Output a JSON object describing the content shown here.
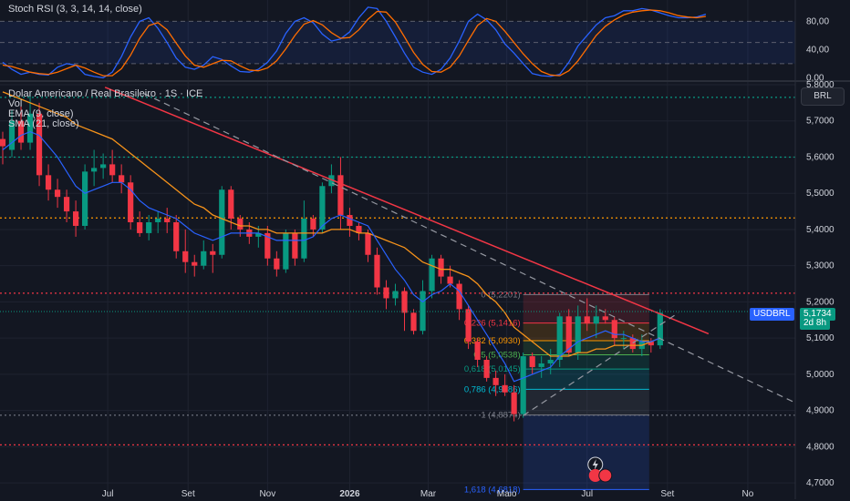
{
  "chart_data": [
    {
      "type": "line",
      "title": "Stoch RSI (3, 3, 14, 14, close)",
      "y_ticks": [
        "80,00",
        "40,00",
        "0,00"
      ],
      "y_tick_values": [
        80,
        40,
        0
      ],
      "ylim": [
        -2,
        105
      ],
      "series": [
        {
          "name": "K",
          "color": "#2962ff",
          "values": [
            22,
            12,
            5,
            8,
            5,
            4,
            15,
            20,
            18,
            5,
            2,
            0,
            8,
            30,
            58,
            80,
            85,
            70,
            50,
            28,
            15,
            12,
            18,
            30,
            26,
            17,
            9,
            8,
            12,
            22,
            38,
            63,
            80,
            85,
            78,
            62,
            52,
            55,
            65,
            85,
            100,
            98,
            80,
            58,
            35,
            15,
            8,
            5,
            12,
            28,
            52,
            80,
            90,
            82,
            68,
            48,
            35,
            20,
            6,
            3,
            2,
            5,
            22,
            45,
            60,
            75,
            85,
            88,
            95,
            95,
            98,
            96,
            92,
            88,
            85,
            85,
            86,
            90
          ]
        },
        {
          "name": "D",
          "color": "#ff6d00",
          "values": [
            18,
            16,
            12,
            8,
            6,
            5,
            8,
            13,
            18,
            14,
            8,
            3,
            3,
            13,
            32,
            56,
            74,
            78,
            68,
            49,
            31,
            18,
            15,
            20,
            25,
            24,
            17,
            11,
            10,
            14,
            24,
            41,
            60,
            76,
            81,
            75,
            64,
            56,
            57,
            68,
            83,
            94,
            93,
            79,
            58,
            36,
            19,
            9,
            8,
            15,
            31,
            53,
            74,
            84,
            80,
            66,
            50,
            34,
            20,
            9,
            4,
            3,
            10,
            24,
            42,
            60,
            73,
            82,
            89,
            93,
            95,
            96,
            95,
            92,
            88,
            86,
            85,
            87
          ]
        }
      ]
    },
    {
      "type": "candlestick",
      "title": "Dolar Americano / Real Brasileiro · 1S · ICE",
      "indicators": [
        "Vol",
        "EMA (9, close)",
        "SMA (21, close)"
      ],
      "currency_button": "BRL",
      "ylim": [
        4.655,
        5.805
      ],
      "y_ticks": [
        "5,8000",
        "5,7000",
        "5,6000",
        "5,5000",
        "5,4000",
        "5,3000",
        "5,2000",
        "5,1000",
        "5,0000",
        "4,9000",
        "4,8000",
        "4,7000"
      ],
      "y_tick_values": [
        5.8,
        5.7,
        5.6,
        5.5,
        5.4,
        5.3,
        5.2,
        5.1,
        5.0,
        4.9,
        4.8,
        4.7
      ],
      "x_ticks": [
        {
          "label": "Jul",
          "index": 11.5
        },
        {
          "label": "Set",
          "index": 20.3
        },
        {
          "label": "Nov",
          "index": 29.0
        },
        {
          "label": "2026",
          "index": 38.0
        },
        {
          "label": "Mar",
          "index": 46.6
        },
        {
          "label": "Maio",
          "index": 55.2
        },
        {
          "label": "Jul",
          "index": 64.0
        },
        {
          "label": "Set",
          "index": 72.8
        },
        {
          "label": "No",
          "index": 81.6
        }
      ],
      "x_range": [
        -0.3,
        86.8
      ],
      "bull_color": "#089981",
      "bear_color": "#f23645",
      "candles": [
        [
          5.65,
          5.67,
          5.58,
          5.63
        ],
        [
          5.62,
          5.73,
          5.6,
          5.7
        ],
        [
          5.7,
          5.74,
          5.62,
          5.64
        ],
        [
          5.64,
          5.78,
          5.62,
          5.72
        ],
        [
          5.72,
          5.75,
          5.52,
          5.55
        ],
        [
          5.55,
          5.58,
          5.48,
          5.51
        ],
        [
          5.51,
          5.54,
          5.46,
          5.49
        ],
        [
          5.49,
          5.51,
          5.42,
          5.45
        ],
        [
          5.45,
          5.48,
          5.38,
          5.41
        ],
        [
          5.41,
          5.58,
          5.4,
          5.56
        ],
        [
          5.56,
          5.62,
          5.52,
          5.57
        ],
        [
          5.57,
          5.61,
          5.54,
          5.58
        ],
        [
          5.58,
          5.62,
          5.53,
          5.55
        ],
        [
          5.55,
          5.58,
          5.5,
          5.53
        ],
        [
          5.53,
          5.55,
          5.4,
          5.42
        ],
        [
          5.42,
          5.45,
          5.38,
          5.39
        ],
        [
          5.39,
          5.44,
          5.37,
          5.42
        ],
        [
          5.42,
          5.45,
          5.39,
          5.43
        ],
        [
          5.43,
          5.46,
          5.39,
          5.42
        ],
        [
          5.42,
          5.44,
          5.32,
          5.34
        ],
        [
          5.34,
          5.4,
          5.28,
          5.31
        ],
        [
          5.31,
          5.33,
          5.27,
          5.3
        ],
        [
          5.3,
          5.37,
          5.29,
          5.34
        ],
        [
          5.34,
          5.36,
          5.28,
          5.33
        ],
        [
          5.33,
          5.52,
          5.32,
          5.51
        ],
        [
          5.51,
          5.52,
          5.4,
          5.43
        ],
        [
          5.43,
          5.44,
          5.38,
          5.4
        ],
        [
          5.4,
          5.42,
          5.36,
          5.38
        ],
        [
          5.38,
          5.41,
          5.35,
          5.39
        ],
        [
          5.39,
          5.41,
          5.3,
          5.32
        ],
        [
          5.32,
          5.34,
          5.27,
          5.29
        ],
        [
          5.29,
          5.4,
          5.28,
          5.39
        ],
        [
          5.39,
          5.4,
          5.3,
          5.32
        ],
        [
          5.32,
          5.48,
          5.31,
          5.43
        ],
        [
          5.43,
          5.44,
          5.38,
          5.4
        ],
        [
          5.4,
          5.53,
          5.39,
          5.52
        ],
        [
          5.52,
          5.58,
          5.5,
          5.55
        ],
        [
          5.55,
          5.6,
          5.4,
          5.44
        ],
        [
          5.44,
          5.46,
          5.38,
          5.41
        ],
        [
          5.41,
          5.42,
          5.37,
          5.39
        ],
        [
          5.39,
          5.4,
          5.31,
          5.33
        ],
        [
          5.33,
          5.35,
          5.22,
          5.24
        ],
        [
          5.24,
          5.26,
          5.18,
          5.21
        ],
        [
          5.21,
          5.25,
          5.19,
          5.23
        ],
        [
          5.23,
          5.24,
          5.12,
          5.17
        ],
        [
          5.17,
          5.18,
          5.11,
          5.12
        ],
        [
          5.12,
          5.26,
          5.11,
          5.23
        ],
        [
          5.23,
          5.33,
          5.21,
          5.32
        ],
        [
          5.32,
          5.33,
          5.25,
          5.27
        ],
        [
          5.27,
          5.3,
          5.24,
          5.25
        ],
        [
          5.25,
          5.26,
          5.15,
          5.18
        ],
        [
          5.18,
          5.19,
          5.07,
          5.09
        ],
        [
          5.09,
          5.1,
          5.02,
          5.04
        ],
        [
          5.04,
          5.05,
          4.98,
          4.99
        ],
        [
          4.99,
          5.01,
          4.94,
          4.97
        ],
        [
          4.97,
          5.0,
          4.94,
          4.95
        ],
        [
          4.95,
          4.97,
          4.87,
          4.89
        ],
        [
          4.89,
          5.06,
          4.88,
          5.05
        ],
        [
          5.05,
          5.06,
          5.0,
          5.02
        ],
        [
          5.02,
          5.05,
          4.99,
          5.03
        ],
        [
          5.03,
          5.07,
          5.0,
          5.04
        ],
        [
          5.04,
          5.17,
          5.02,
          5.16
        ],
        [
          5.16,
          5.18,
          5.05,
          5.06
        ],
        [
          5.06,
          5.19,
          5.04,
          5.16
        ],
        [
          5.16,
          5.21,
          5.12,
          5.14
        ],
        [
          5.14,
          5.19,
          5.1,
          5.16
        ],
        [
          5.16,
          5.18,
          5.14,
          5.15
        ],
        [
          5.15,
          5.16,
          5.08,
          5.1
        ],
        [
          5.1,
          5.12,
          5.07,
          5.1
        ],
        [
          5.1,
          5.11,
          5.06,
          5.07
        ],
        [
          5.07,
          5.11,
          5.05,
          5.09
        ],
        [
          5.09,
          5.1,
          5.06,
          5.08
        ],
        [
          5.08,
          5.18,
          5.07,
          5.17
        ]
      ],
      "ema9_color": "#2962ff",
      "ema9": [
        5.62,
        5.64,
        5.66,
        5.67,
        5.66,
        5.63,
        5.6,
        5.56,
        5.52,
        5.5,
        5.51,
        5.52,
        5.53,
        5.53,
        5.51,
        5.48,
        5.46,
        5.45,
        5.44,
        5.43,
        5.41,
        5.39,
        5.38,
        5.37,
        5.38,
        5.39,
        5.39,
        5.39,
        5.39,
        5.38,
        5.37,
        5.37,
        5.37,
        5.37,
        5.38,
        5.41,
        5.43,
        5.44,
        5.43,
        5.42,
        5.41,
        5.37,
        5.33,
        5.29,
        5.26,
        5.22,
        5.2,
        5.22,
        5.23,
        5.25,
        5.23,
        5.19,
        5.15,
        5.11,
        5.07,
        5.03,
        4.98,
        4.99,
        5.0,
        5.01,
        5.02,
        5.05,
        5.07,
        5.09,
        5.1,
        5.11,
        5.12,
        5.11,
        5.11,
        5.1,
        5.09,
        5.09,
        5.1
      ],
      "sma21_color": "#f7931a",
      "sma21": [
        5.78,
        5.77,
        5.76,
        5.75,
        5.74,
        5.73,
        5.72,
        5.71,
        5.69,
        5.68,
        5.67,
        5.66,
        5.65,
        5.63,
        5.61,
        5.59,
        5.57,
        5.55,
        5.53,
        5.51,
        5.49,
        5.47,
        5.46,
        5.44,
        5.43,
        5.42,
        5.41,
        5.41,
        5.4,
        5.4,
        5.39,
        5.39,
        5.39,
        5.39,
        5.39,
        5.39,
        5.4,
        5.4,
        5.4,
        5.39,
        5.39,
        5.38,
        5.37,
        5.36,
        5.35,
        5.33,
        5.31,
        5.3,
        5.29,
        5.29,
        5.28,
        5.27,
        5.25,
        5.22,
        5.2,
        5.17,
        5.13,
        5.11,
        5.09,
        5.07,
        5.05,
        5.05,
        5.05,
        5.06,
        5.06,
        5.07,
        5.07,
        5.08,
        5.08,
        5.08,
        5.08,
        5.09,
        5.1
      ],
      "horizontal_lines": [
        {
          "value": 5.765,
          "color": "#089981",
          "style": "dotted"
        },
        {
          "value": 5.6,
          "color": "#089981",
          "style": "dotted"
        },
        {
          "value": 5.432,
          "color": "#ff9800",
          "style": "dotted"
        },
        {
          "value": 5.224,
          "color": "#f23645",
          "style": "dotted"
        },
        {
          "value": 4.887,
          "color": "#787b86",
          "style": "dotted"
        },
        {
          "value": 4.805,
          "color": "#f23645",
          "style": "dotted"
        }
      ],
      "trendlines": [
        {
          "from": [
            11.2,
            5.793
          ],
          "to": [
            77.3,
            5.112
          ],
          "color": "#f23645",
          "style": "solid"
        },
        {
          "from": [
            15.5,
            5.775
          ],
          "to": [
            86.5,
            4.925
          ],
          "color": "#9598a1",
          "style": "dashed"
        },
        {
          "from": [
            57.0,
            4.886
          ],
          "to": [
            74.0,
            5.17
          ],
          "color": "#9598a1",
          "style": "dashed"
        }
      ],
      "fibonacci": {
        "from_index": 57.0,
        "to_index": 70.8,
        "levels": [
          {
            "label": "0 (5,2201)",
            "value": 5.2201,
            "color": "#787b86"
          },
          {
            "label": "0,236 (5,1416)",
            "value": 5.1416,
            "color": "#f23645"
          },
          {
            "label": "0,382 (5,0930)",
            "value": 5.093,
            "color": "#ff9800"
          },
          {
            "label": "0,5 (5,0538)",
            "value": 5.0538,
            "color": "#4caf50"
          },
          {
            "label": "0,618 (5,0145)",
            "value": 5.0145,
            "color": "#089981"
          },
          {
            "label": "0,786 (4,9586)",
            "value": 4.9586,
            "color": "#00bcd4"
          },
          {
            "label": "1 (4,8874)",
            "value": 4.8874,
            "color": "#787b86"
          },
          {
            "label": "1,618 (4,6818)",
            "value": 4.6818,
            "color": "#2962ff"
          }
        ]
      },
      "last_price": {
        "symbol": "USDBRL",
        "value": 5.1734,
        "price": "5,1734",
        "countdown": "2d 8h"
      }
    }
  ]
}
